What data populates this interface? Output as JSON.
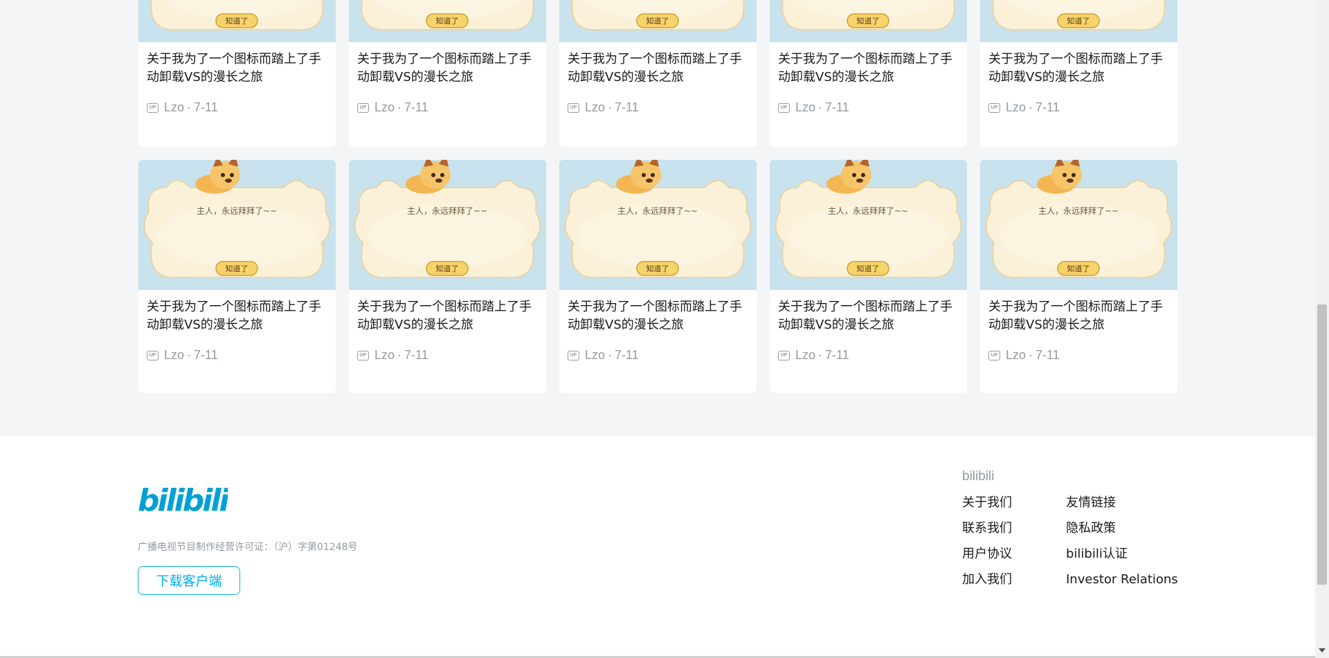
{
  "videos": [
    {
      "title": "关于我为了一个图标而踏上了手动卸载VS的漫长之旅",
      "author": "Lzo",
      "date": "7-11",
      "image_text": "知道了"
    },
    {
      "title": "关于我为了一个图标而踏上了手动卸载VS的漫长之旅",
      "author": "Lzo",
      "date": "7-11",
      "image_text": "知道了"
    },
    {
      "title": "关于我为了一个图标而踏上了手动卸载VS的漫长之旅",
      "author": "Lzo",
      "date": "7-11",
      "image_text": "知道了"
    },
    {
      "title": "关于我为了一个图标而踏上了手动卸载VS的漫长之旅",
      "author": "Lzo",
      "date": "7-11",
      "image_text": "知道了"
    },
    {
      "title": "关于我为了一个图标而踏上了手动卸载VS的漫长之旅",
      "author": "Lzo",
      "date": "7-11",
      "image_text": "知道了"
    },
    {
      "title": "关于我为了一个图标而踏上了手动卸载VS的漫长之旅",
      "author": "Lzo",
      "date": "7-11",
      "image_text": "主人，永远拜拜了~~",
      "image_button": "知道了"
    },
    {
      "title": "关于我为了一个图标而踏上了手动卸载VS的漫长之旅",
      "author": "Lzo",
      "date": "7-11",
      "image_text": "主人，永远拜拜了~~",
      "image_button": "知道了"
    },
    {
      "title": "关于我为了一个图标而踏上了手动卸载VS的漫长之旅",
      "author": "Lzo",
      "date": "7-11",
      "image_text": "主人，永远拜拜了~~",
      "image_button": "知道了"
    },
    {
      "title": "关于我为了一个图标而踏上了手动卸载VS的漫长之旅",
      "author": "Lzo",
      "date": "7-11",
      "image_text": "主人，永远拜拜了~~",
      "image_button": "知道了"
    },
    {
      "title": "关于我为了一个图标而踏上了手动卸载VS的漫长之旅",
      "author": "Lzo",
      "date": "7-11",
      "image_text": "主人，永远拜拜了~~",
      "image_button": "知道了"
    }
  ],
  "up_badge": "UP",
  "meta_separator": "·",
  "footer": {
    "logo_text": "bilibili",
    "license": "广播电视节目制作经营许可证：（沪）字第01248号",
    "download_label": "下载客户端",
    "links_title": "bilibili",
    "links": [
      "关于我们",
      "友情链接",
      "联系我们",
      "隐私政策",
      "用户协议",
      "bilibili认证",
      "加入我们",
      "Investor Relations"
    ]
  },
  "colors": {
    "accent": "#00aeec",
    "logo": "#00a1d6",
    "muted": "#9499a0"
  }
}
